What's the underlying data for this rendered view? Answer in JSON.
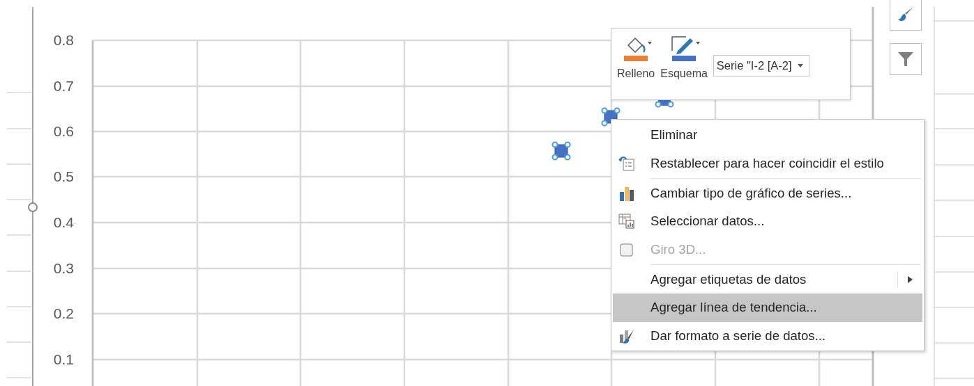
{
  "chart": {
    "y_labels": [
      "0.8",
      "0.7",
      "0.6",
      "0.5",
      "0.4",
      "0.3",
      "0.2",
      "0.1"
    ]
  },
  "side_buttons": [
    {
      "kind": "brush"
    },
    {
      "kind": "filter"
    }
  ],
  "mini_toolbar": {
    "buttons": [
      {
        "label": "Relleno",
        "kind": "fill",
        "color": "#ed7d31"
      },
      {
        "label": "Esquema",
        "kind": "outline",
        "color": "#4472c4"
      }
    ],
    "series_dropdown": {
      "value": "Serie \"I-2 [A-2]"
    }
  },
  "context_menu": {
    "items": [
      {
        "label": "Eliminar",
        "kind": "none",
        "disabled": false,
        "selected": false,
        "submenu": false,
        "separator_before": false
      },
      {
        "label": "Restablecer para hacer coincidir el estilo",
        "kind": "reset",
        "disabled": false,
        "selected": false,
        "submenu": false,
        "separator_before": false
      },
      {
        "label": "Cambiar tipo de gráfico de series...",
        "kind": "chart-type",
        "disabled": false,
        "selected": false,
        "submenu": false,
        "separator_before": true
      },
      {
        "label": "Seleccionar datos...",
        "kind": "select-data",
        "disabled": false,
        "selected": false,
        "submenu": false,
        "separator_before": false
      },
      {
        "label": "Giro 3D...",
        "kind": "rotate-3d",
        "disabled": true,
        "selected": false,
        "submenu": false,
        "separator_before": false
      },
      {
        "label": "Agregar etiquetas de datos",
        "kind": "none",
        "disabled": false,
        "selected": false,
        "submenu": true,
        "separator_before": true
      },
      {
        "label": "Agregar línea de tendencia...",
        "kind": "none",
        "disabled": false,
        "selected": true,
        "submenu": false,
        "separator_before": false
      },
      {
        "label": "Dar formato a serie de datos...",
        "kind": "format",
        "disabled": false,
        "selected": false,
        "submenu": false,
        "separator_before": false
      }
    ]
  }
}
